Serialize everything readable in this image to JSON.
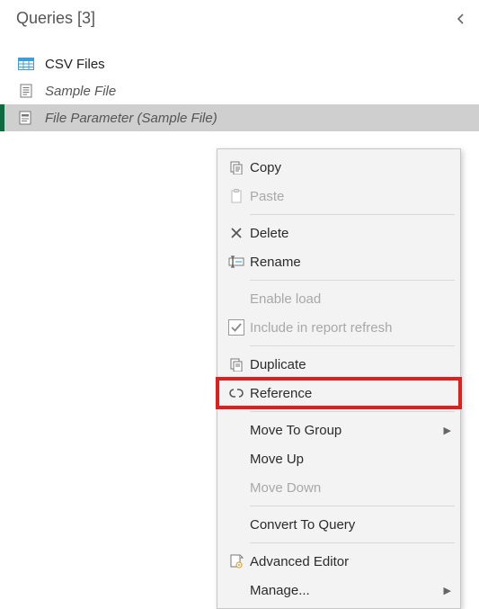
{
  "panel": {
    "title": "Queries [3]"
  },
  "queries": [
    {
      "label": "CSV Files",
      "icon": "table"
    },
    {
      "label": "Sample File",
      "icon": "document"
    },
    {
      "label": "File Parameter (Sample File)",
      "icon": "parameter"
    }
  ],
  "menu": {
    "copy": "Copy",
    "paste": "Paste",
    "delete": "Delete",
    "rename": "Rename",
    "enable_load": "Enable load",
    "include_refresh": "Include in report refresh",
    "duplicate": "Duplicate",
    "reference": "Reference",
    "move_to_group": "Move To Group",
    "move_up": "Move Up",
    "move_down": "Move Down",
    "convert_to_query": "Convert To Query",
    "advanced_editor": "Advanced Editor",
    "manage": "Manage..."
  }
}
